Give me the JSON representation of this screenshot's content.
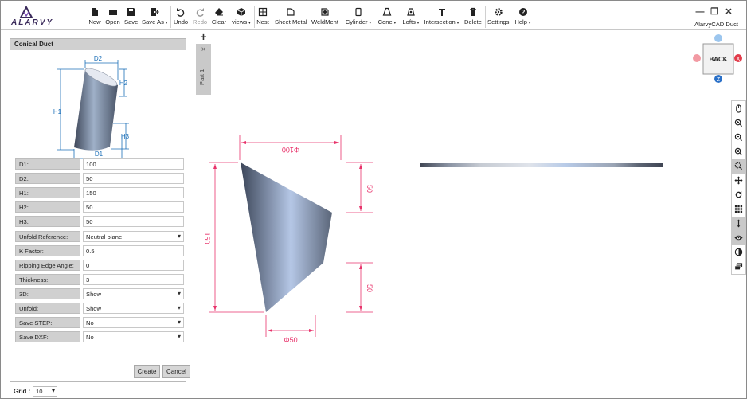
{
  "app": {
    "logo_text": "ALARVY",
    "title": "AlarvyCAD Duct"
  },
  "toolbar": {
    "new": "New",
    "open": "Open",
    "save": "Save",
    "save_as": "Save As",
    "undo": "Undo",
    "redo": "Redo",
    "clear": "Clear",
    "views": "views",
    "nest": "Nest",
    "sheet_metal": "Sheet Metal",
    "weldment": "WeldMent",
    "cylinder": "Cylinder",
    "cone": "Cone",
    "lofts": "Lofts",
    "intersection": "Intersection",
    "delete": "Delete",
    "settings": "Settings",
    "help": "Help"
  },
  "panel": {
    "title": "Conical Duct",
    "diagram_labels": {
      "d2": "D2",
      "d1": "D1",
      "h1": "H1",
      "h2": "H2",
      "h3": "H3"
    },
    "fields": [
      {
        "label": "D1:",
        "value": "100"
      },
      {
        "label": "D2:",
        "value": "50"
      },
      {
        "label": "H1:",
        "value": "150"
      },
      {
        "label": "H2:",
        "value": "50"
      },
      {
        "label": "H3:",
        "value": "50"
      },
      {
        "label": "Unfold Reference:",
        "value": "Neutral plane",
        "select": true
      },
      {
        "label": "K Factor:",
        "value": "0.5"
      },
      {
        "label": "Ripping Edge Angle:",
        "value": "0"
      },
      {
        "label": "Thickness:",
        "value": "3"
      },
      {
        "label": "3D:",
        "value": "Show",
        "select": true
      },
      {
        "label": "Unfold:",
        "value": "Show",
        "select": true
      },
      {
        "label": "Save STEP:",
        "value": "No",
        "select": true
      },
      {
        "label": "Save DXF:",
        "value": "No",
        "select": true
      }
    ],
    "create": "Create",
    "cancel": "Cancel"
  },
  "part_tab": {
    "label": "Part 1",
    "add": "+",
    "close": "×"
  },
  "view_cube": {
    "label": "BACK"
  },
  "drawing": {
    "d1": "Φ100",
    "d2": "Φ50",
    "h1": "150",
    "h2": "50",
    "h3": "50",
    "dim_color": "#e8336b"
  },
  "status": {
    "grid_label": "Grid :",
    "grid_value": "10"
  }
}
